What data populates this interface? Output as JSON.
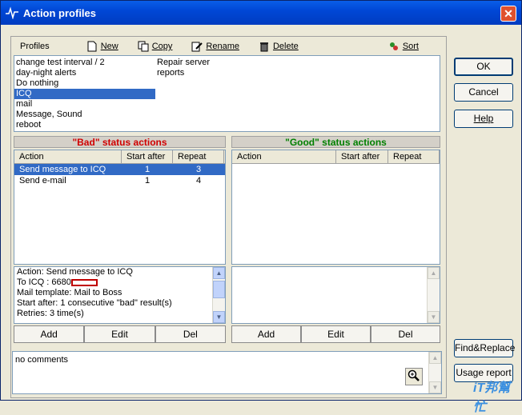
{
  "window": {
    "title": "Action profiles",
    "close_glyph": "✕"
  },
  "toolbar": {
    "label": "Profiles",
    "new": "New",
    "copy": "Copy",
    "rename": "Rename",
    "delete": "Delete",
    "sort": "Sort"
  },
  "profiles": {
    "col1": [
      "change test interval / 2",
      "day-night alerts",
      "Do nothing",
      "ICQ",
      "mail",
      "Message, Sound",
      "reboot"
    ],
    "col2": [
      "Repair server",
      "reports"
    ],
    "selected": "ICQ"
  },
  "bad": {
    "header": "\"Bad\" status actions",
    "columns": [
      "Action",
      "Start after",
      "Repeat"
    ],
    "rows": [
      {
        "action": "Send message to ICQ",
        "start": "1",
        "repeat": "3"
      },
      {
        "action": "Send e-mail",
        "start": "1",
        "repeat": "4"
      }
    ],
    "details": [
      "Action: Send message to ICQ",
      "To ICQ    : 6680",
      "Mail template: Mail to Boss",
      "Start after: 1 consecutive \"bad\" result(s)",
      "Retries: 3 time(s)"
    ],
    "buttons": {
      "add": "Add",
      "edit": "Edit",
      "del": "Del"
    }
  },
  "good": {
    "header": "\"Good\" status actions",
    "columns": [
      "Action",
      "Start after",
      "Repeat"
    ],
    "buttons": {
      "add": "Add",
      "edit": "Edit",
      "del": "Del"
    }
  },
  "comments": {
    "text": "no comments"
  },
  "side_buttons": {
    "ok": "OK",
    "cancel": "Cancel",
    "help": "Help",
    "find_replace": "Find&Replace",
    "usage_report": "Usage report"
  },
  "watermark": "iT邦幫忙",
  "colors": {
    "title_bar": "#0047d6",
    "selection": "#316ac5",
    "bad_header": "#d00000",
    "good_header": "#008000"
  }
}
